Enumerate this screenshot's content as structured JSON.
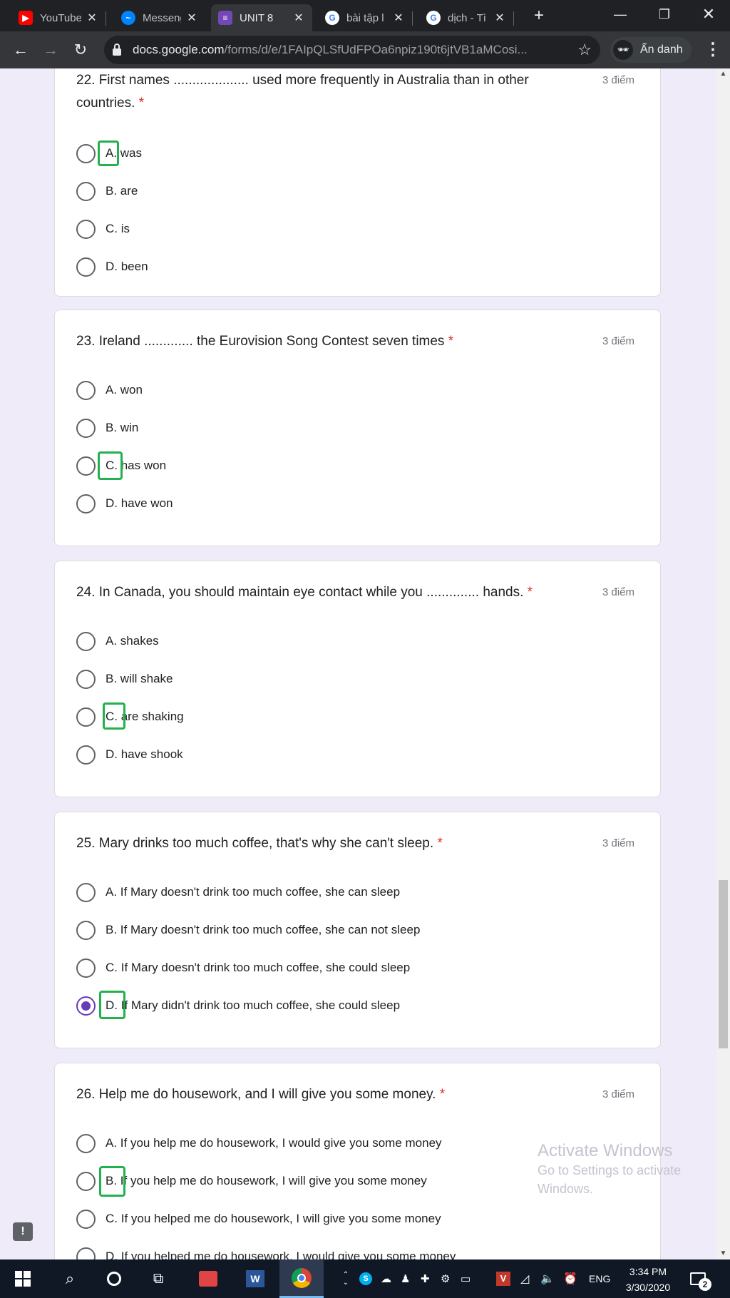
{
  "browser": {
    "tabs": [
      {
        "title": "YouTube",
        "icon": "youtube-icon",
        "color": "#ff0000"
      },
      {
        "title": "Messenger",
        "icon": "messenger-icon",
        "color": "#0084ff"
      },
      {
        "title": "UNIT 8",
        "icon": "forms-icon",
        "color": "#7248b9",
        "active": true
      },
      {
        "title": "bài tập l",
        "icon": "google-icon",
        "color": "#4285f4"
      },
      {
        "title": "dịch - Tì",
        "icon": "google-icon",
        "color": "#4285f4"
      }
    ],
    "url_host": "docs.google.com",
    "url_path": "/forms/d/e/1FAIpQLSfUdFPOa6npiz190t6jtVB1aMCosi...",
    "profile_label": "Ẩn danh"
  },
  "questions": [
    {
      "title": "22. First names .................... used more frequently in Australia than in other countries.",
      "required": "*",
      "points": "3 điểm",
      "options": [
        "A. was",
        "B. are",
        "C. is",
        "D. been"
      ],
      "selected": null
    },
    {
      "title": "23. Ireland ............. the Eurovision Song Contest seven times",
      "required": "*",
      "points": "3 điểm",
      "options": [
        "A. won",
        "B. win",
        "C. has won",
        "D. have won"
      ],
      "selected": null
    },
    {
      "title": "24. In Canada, you should maintain eye contact while you .............. hands.",
      "required": "*",
      "points": "3 điểm",
      "options": [
        "A. shakes",
        "B. will shake",
        "C. are shaking",
        "D. have shook"
      ],
      "selected": null
    },
    {
      "title": "25. Mary drinks too much coffee, that's why she can't sleep.",
      "required": "*",
      "points": "3 điểm",
      "options": [
        "A. If Mary doesn't drink too much coffee, she can sleep",
        "B. If Mary doesn't drink too much coffee, she can not sleep",
        "C. If Mary doesn't drink too much coffee, she could sleep",
        "D. If Mary didn't drink too much coffee, she could sleep"
      ],
      "selected": 3
    },
    {
      "title": "26. Help me do housework, and I will give you some money.",
      "required": "*",
      "points": "3 điểm",
      "options": [
        "A. If you help me do housework, I would give you some money",
        "B. If you help me do housework, I will give you some money",
        "C. If you helped me do housework, I will give you some money",
        "D. If you helped me do housework, I would give you some money"
      ],
      "selected": null
    }
  ],
  "watermark": {
    "line1": "Activate Windows",
    "line2": "Go to Settings to activate",
    "line3": "Windows."
  },
  "taskbar": {
    "language": "ENG",
    "time": "3:34 PM",
    "date": "3/30/2020",
    "notification_count": "2"
  }
}
